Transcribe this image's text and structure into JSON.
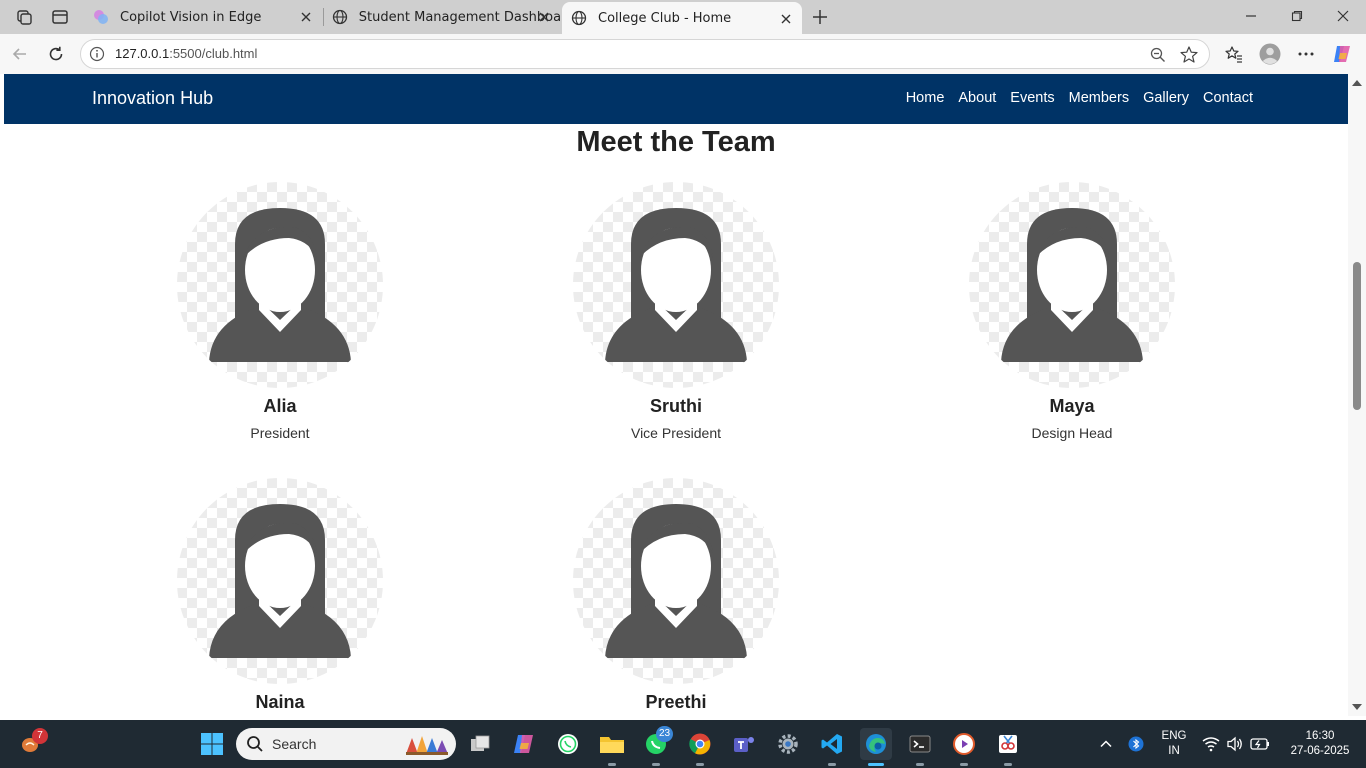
{
  "browser": {
    "tabs": [
      {
        "title": "Copilot Vision in Edge",
        "active": false
      },
      {
        "title": "Student Management Dashboard",
        "active": false
      },
      {
        "title": "College Club - Home",
        "active": true
      }
    ],
    "url_host": "127.0.0.1",
    "url_rest": ":5500/club.html"
  },
  "site": {
    "brand": "Innovation Hub",
    "nav": [
      "Home",
      "About",
      "Events",
      "Members",
      "Gallery",
      "Contact"
    ],
    "section_title": "Meet the Team",
    "members": [
      {
        "name": "Alia",
        "role": "President"
      },
      {
        "name": "Sruthi",
        "role": "Vice President"
      },
      {
        "name": "Maya",
        "role": "Design Head"
      },
      {
        "name": "Naina",
        "role": ""
      },
      {
        "name": "Preethi",
        "role": ""
      }
    ]
  },
  "taskbar": {
    "search_label": "Search",
    "notification_badge": "7",
    "whatsapp_badge": "23",
    "language": "ENG",
    "region": "IN",
    "time": "16:30",
    "date": "27-06-2025"
  },
  "colors": {
    "navbar": "#003366",
    "avatar": "#555555",
    "taskbar": "#1f2a33"
  }
}
